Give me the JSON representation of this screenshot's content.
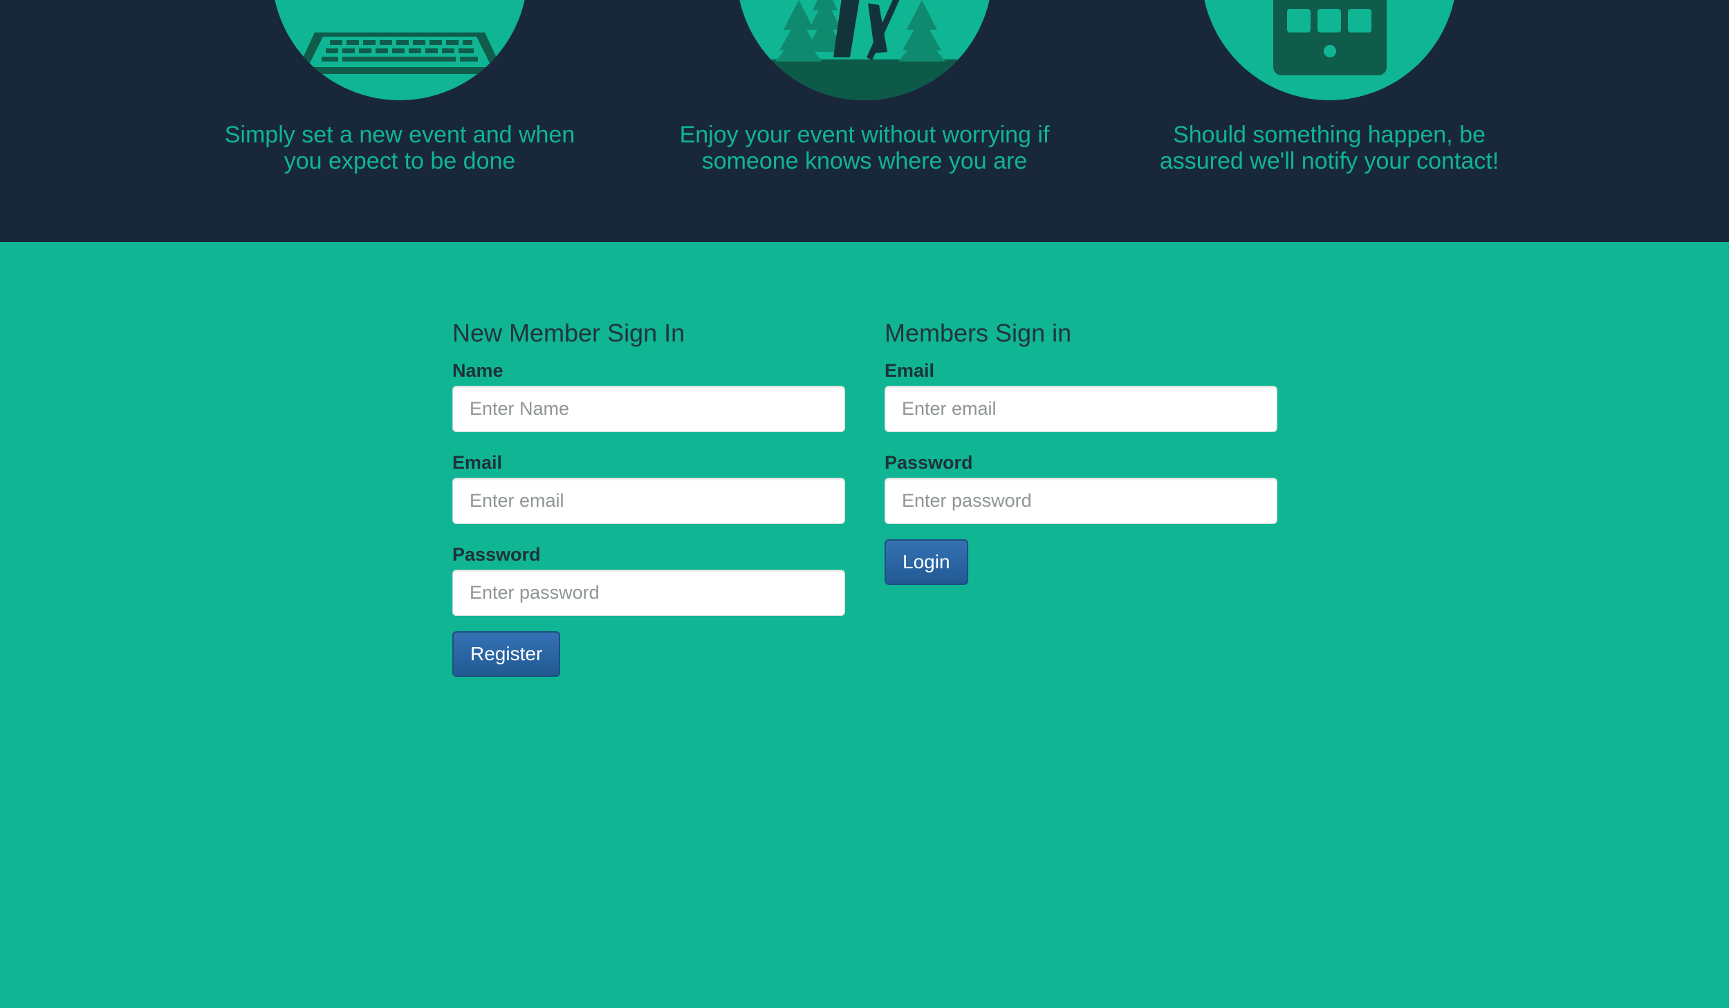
{
  "features": [
    {
      "icon": "laptop-icon",
      "caption_line1": "Simply set a new event and when",
      "caption_line2": "you expect to be done"
    },
    {
      "icon": "hiker-forest-icon",
      "caption_line1": "Enjoy your event without worrying if",
      "caption_line2": "someone knows where you are"
    },
    {
      "icon": "tablet-icon",
      "caption_line1": "Should something happen, be",
      "caption_line2": "assured we'll notify your contact!"
    }
  ],
  "register_form": {
    "title": "New Member Sign In",
    "name_label": "Name",
    "name_placeholder": "Enter Name",
    "email_label": "Email",
    "email_placeholder": "Enter email",
    "password_label": "Password",
    "password_placeholder": "Enter password",
    "submit_label": "Register"
  },
  "login_form": {
    "title": "Members Sign in",
    "email_label": "Email",
    "email_placeholder": "Enter email",
    "password_label": "Password",
    "password_placeholder": "Enter password",
    "submit_label": "Login"
  },
  "colors": {
    "hero_background": "#19273a",
    "page_background": "#10b594",
    "accent": "#10b594",
    "button": "#2a64a3"
  }
}
